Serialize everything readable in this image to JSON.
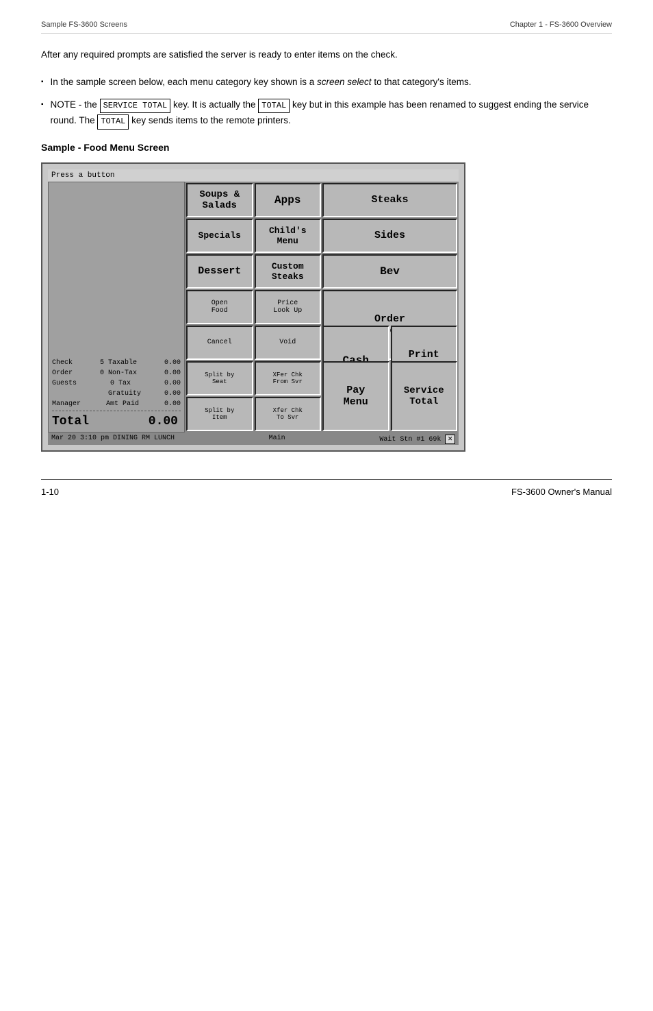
{
  "header": {
    "left": "Sample FS-3600 Screens",
    "right": "Chapter 1 - FS-3600 Overview"
  },
  "intro_text": "After any required prompts are satisfied the server is ready to enter items on the check.",
  "bullets": [
    {
      "text": "In the sample screen below, each menu category key shown is a screen select to that category's items.",
      "italic_phrase": "screen select"
    },
    {
      "text": "NOTE - the SERVICE TOTAL key.  It is actually the TOTAL key but in this example has been renamed to suggest ending the service round.  The TOTAL key sends items to the remote printers.",
      "keys": [
        "SERVICE TOTAL",
        "TOTAL",
        "TOTAL"
      ]
    }
  ],
  "section_title": "Sample - Food Menu Screen",
  "pos": {
    "top_bar": "Press a button",
    "buttons": [
      {
        "label": "Soups &\nSalads",
        "size": "medium-text"
      },
      {
        "label": "Apps",
        "size": "medium-text"
      },
      {
        "label": "Steaks",
        "size": "medium-text"
      },
      {
        "label": "Specials",
        "size": "medium-text"
      },
      {
        "label": "Child's\nMenu",
        "size": "medium-text"
      },
      {
        "label": "Sides",
        "size": "medium-text"
      },
      {
        "label": "Dessert",
        "size": "medium-text"
      },
      {
        "label": "Custom\nSteaks",
        "size": "medium-text"
      },
      {
        "label": "Bev",
        "size": "medium-text"
      },
      {
        "label": "Open\nFood",
        "size": "small-text"
      },
      {
        "label": "Price\nLook Up",
        "size": "small-text"
      },
      {
        "label": "Order\nScreen",
        "size": "medium-text"
      },
      {
        "label": "Cancel",
        "size": "small-text"
      },
      {
        "label": "Void",
        "size": "small-text"
      },
      {
        "label": "Cash",
        "size": "medium-text"
      },
      {
        "label": "Print\nCheck",
        "size": "medium-text"
      },
      {
        "label": "Split by\nSeat",
        "size": "small-text"
      },
      {
        "label": "XFer Chk\nFrom Svr",
        "size": "small-text"
      },
      {
        "label": "Pay\nMenu",
        "size": "medium-text"
      },
      {
        "label": "Service\nTotal",
        "size": "medium-text"
      },
      {
        "label": "Split by\nItem",
        "size": "small-text"
      },
      {
        "label": "Xfer Chk\nTo Svr",
        "size": "small-text"
      }
    ],
    "check_info": {
      "check_label": "Check",
      "check_val": "5",
      "taxable_label": "Taxable",
      "taxable_val": "0.00",
      "order_label": "Order",
      "order_val": "",
      "nontax_label": "0 Non-Tax",
      "nontax_val": "0.00",
      "guests_label": "Guests",
      "guests_val": "",
      "tax_label": "0 Tax",
      "tax_val": "0.00",
      "gratuity_label": "Gratuity",
      "gratuity_val": "0.00",
      "manager_label": "Manager",
      "amtpaid_label": "Amt Paid",
      "amtpaid_val": "0.00",
      "total_label": "Total",
      "total_val": "0.00"
    },
    "status_bar": {
      "left": "Mar 20  3:10 pm  DINING RM   LUNCH",
      "center": "Main",
      "right": "Wait Stn #1  69k"
    }
  },
  "footer": {
    "left": "1-10",
    "right": "FS-3600 Owner's Manual"
  }
}
